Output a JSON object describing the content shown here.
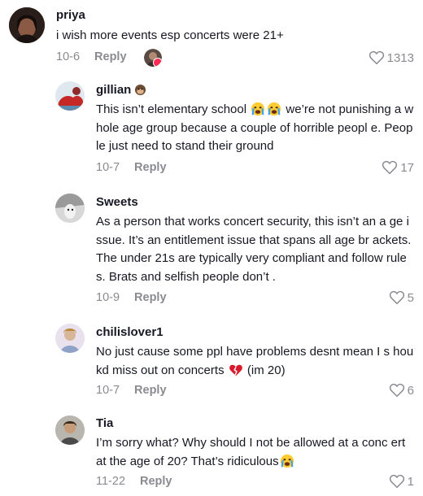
{
  "comments": [
    {
      "username": "priya",
      "text": "i wish more events esp concerts were 21+",
      "date": "10-6",
      "reply_label": "Reply",
      "likes": "1313"
    },
    {
      "username": "gillian",
      "text_before": "This isn’t elementary school ",
      "text_after": " we’re not punishing a whole age group because a couple of horrible peopl e. People just need to stand their ground",
      "date": "10-7",
      "reply_label": "Reply",
      "likes": "17"
    },
    {
      "username": "Sweets",
      "text": "As a person that works concert security, this isn’t an a ge issue. It’s an entitlement issue that spans all age br ackets. The under 21s are typically very compliant and follow rules. Brats and selfish people don’t .",
      "date": "10-9",
      "reply_label": "Reply",
      "likes": "5"
    },
    {
      "username": "chilislover1",
      "text_before": "No just cause some ppl have problems desnt mean I s houkd miss out on concerts ",
      "text_after": " (im 20)",
      "date": "10-7",
      "reply_label": "Reply",
      "likes": "6"
    },
    {
      "username": "Tia",
      "text_before": "I’m sorry what? Why should I not be allowed at a conc ert at the age of 20? That’s ridiculous",
      "date": "11-22",
      "reply_label": "Reply",
      "likes": "1"
    }
  ],
  "colors": {
    "text": "#161823",
    "secondary": "#8a8b91",
    "accent": "#fe2c55"
  },
  "icons": {
    "like": "heart-outline-icon",
    "broken_heart": "broken-heart-emoji",
    "crying": "crying-face-emoji"
  }
}
